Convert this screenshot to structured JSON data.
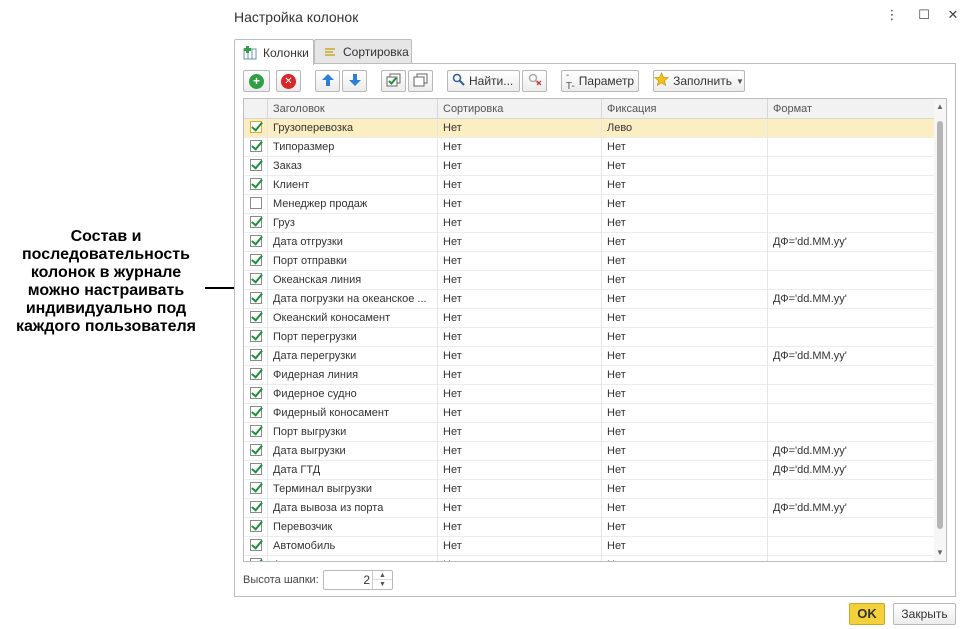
{
  "annotation": {
    "text": "Состав и последовательность колонок в журнале можно настраивать индивидуально под каждого пользователя"
  },
  "dialog": {
    "title": "Настройка колонок",
    "window_buttons": [
      "⋮",
      "☐",
      "✕"
    ]
  },
  "tabs": [
    {
      "label": "Колонки",
      "icon": "columns-icon",
      "active": true
    },
    {
      "label": "Сортировка",
      "icon": "sort-icon",
      "active": false
    }
  ],
  "toolbar": {
    "find_label": "Найти...",
    "param_label": "Параметр",
    "fill_label": "Заполнить"
  },
  "grid": {
    "headers": [
      "Заголовок",
      "Сортировка",
      "Фиксация",
      "Формат"
    ],
    "rows": [
      {
        "checked": true,
        "title": "Грузоперевозка",
        "sort": "Нет",
        "fix": "Лево",
        "format": ""
      },
      {
        "checked": true,
        "title": "Типоразмер",
        "sort": "Нет",
        "fix": "Нет",
        "format": ""
      },
      {
        "checked": true,
        "title": "Заказ",
        "sort": "Нет",
        "fix": "Нет",
        "format": ""
      },
      {
        "checked": true,
        "title": "Клиент",
        "sort": "Нет",
        "fix": "Нет",
        "format": ""
      },
      {
        "checked": false,
        "title": "Менеджер продаж",
        "sort": "Нет",
        "fix": "Нет",
        "format": ""
      },
      {
        "checked": true,
        "title": "Груз",
        "sort": "Нет",
        "fix": "Нет",
        "format": ""
      },
      {
        "checked": true,
        "title": "Дата отгрузки",
        "sort": "Нет",
        "fix": "Нет",
        "format": "ДФ='dd.MM.yy'"
      },
      {
        "checked": true,
        "title": "Порт отправки",
        "sort": "Нет",
        "fix": "Нет",
        "format": ""
      },
      {
        "checked": true,
        "title": "Океанская линия",
        "sort": "Нет",
        "fix": "Нет",
        "format": ""
      },
      {
        "checked": true,
        "title": "Дата погрузки на океанское ...",
        "sort": "Нет",
        "fix": "Нет",
        "format": "ДФ='dd.MM.yy'"
      },
      {
        "checked": true,
        "title": "Океанский коносамент",
        "sort": "Нет",
        "fix": "Нет",
        "format": ""
      },
      {
        "checked": true,
        "title": "Порт перегрузки",
        "sort": "Нет",
        "fix": "Нет",
        "format": ""
      },
      {
        "checked": true,
        "title": "Дата перегрузки",
        "sort": "Нет",
        "fix": "Нет",
        "format": "ДФ='dd.MM.yy'"
      },
      {
        "checked": true,
        "title": "Фидерная линия",
        "sort": "Нет",
        "fix": "Нет",
        "format": ""
      },
      {
        "checked": true,
        "title": "Фидерное судно",
        "sort": "Нет",
        "fix": "Нет",
        "format": ""
      },
      {
        "checked": true,
        "title": "Фидерный коносамент",
        "sort": "Нет",
        "fix": "Нет",
        "format": ""
      },
      {
        "checked": true,
        "title": "Порт выгрузки",
        "sort": "Нет",
        "fix": "Нет",
        "format": ""
      },
      {
        "checked": true,
        "title": "Дата выгрузки",
        "sort": "Нет",
        "fix": "Нет",
        "format": "ДФ='dd.MM.yy'"
      },
      {
        "checked": true,
        "title": "Дата ГТД",
        "sort": "Нет",
        "fix": "Нет",
        "format": "ДФ='dd.MM.yy'"
      },
      {
        "checked": true,
        "title": "Терминал выгрузки",
        "sort": "Нет",
        "fix": "Нет",
        "format": ""
      },
      {
        "checked": true,
        "title": "Дата вывоза из порта",
        "sort": "Нет",
        "fix": "Нет",
        "format": "ДФ='dd.MM.yy'"
      },
      {
        "checked": true,
        "title": "Перевозчик",
        "sort": "Нет",
        "fix": "Нет",
        "format": ""
      },
      {
        "checked": true,
        "title": "Автомобиль",
        "sort": "Нет",
        "fix": "Нет",
        "format": ""
      },
      {
        "checked": true,
        "title": "А...",
        "sort": "Н...",
        "fix": "Н...",
        "format": ""
      }
    ]
  },
  "footer": {
    "header_height_label": "Высота шапки:",
    "header_height_value": "2",
    "ok_label": "OK",
    "close_label": "Закрыть"
  },
  "colors": {
    "selected_row": "#fbeec3",
    "check": "#1e8f3a",
    "ok_button": "#f4d03a"
  }
}
